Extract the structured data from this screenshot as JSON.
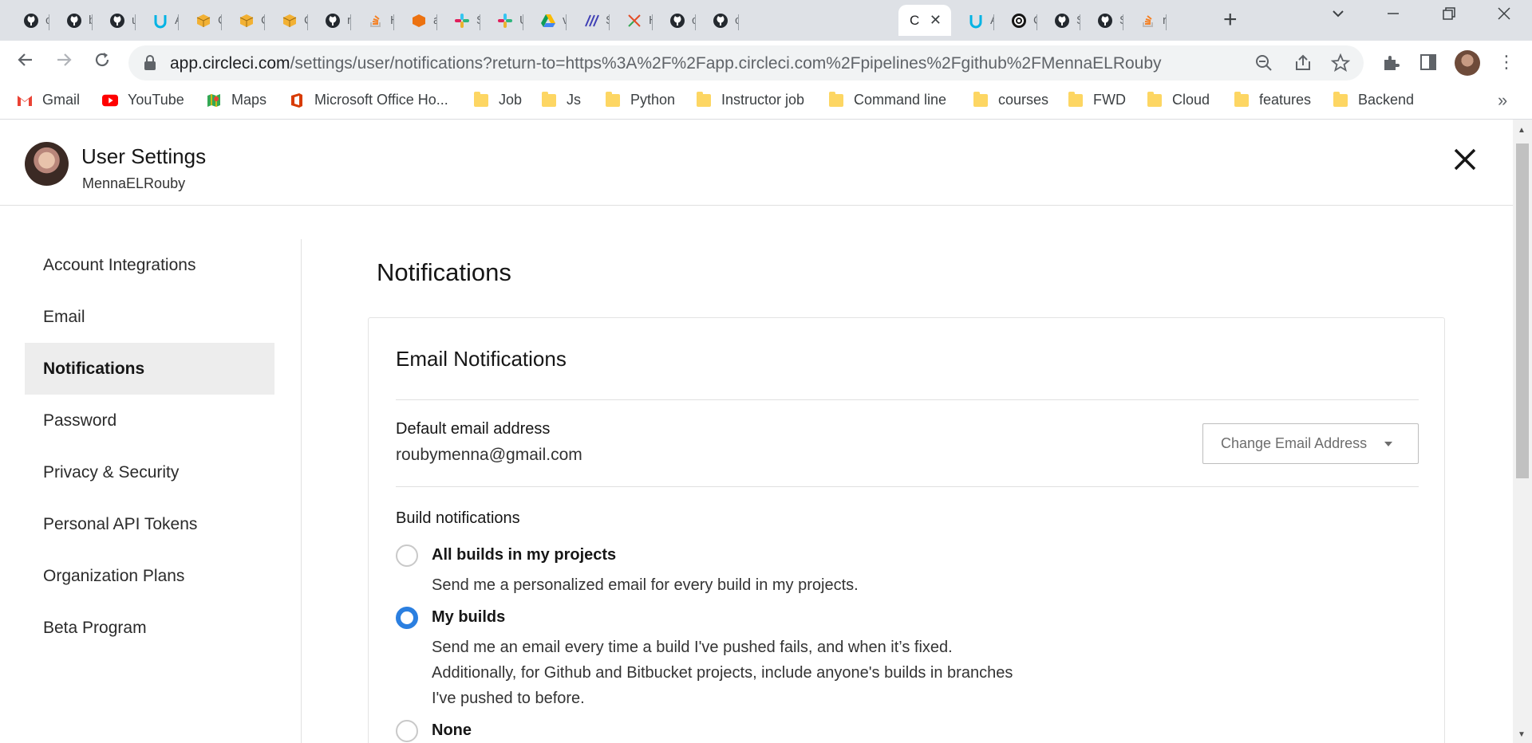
{
  "browser": {
    "tabs": [
      {
        "icon": "github-icon",
        "title": "c"
      },
      {
        "icon": "github-icon",
        "title": "b"
      },
      {
        "icon": "github-icon",
        "title": "u"
      },
      {
        "icon": "udacity-icon",
        "title": "A"
      },
      {
        "icon": "package-icon",
        "title": "C"
      },
      {
        "icon": "package-icon",
        "title": "C"
      },
      {
        "icon": "package-icon",
        "title": "C"
      },
      {
        "icon": "github-icon",
        "title": "r"
      },
      {
        "icon": "stackoverflow-icon",
        "title": "H"
      },
      {
        "icon": "aws-icon",
        "title": "a"
      },
      {
        "icon": "slack-icon",
        "title": "S"
      },
      {
        "icon": "slack-icon",
        "title": "U"
      },
      {
        "icon": "google-drive-icon",
        "title": "v"
      },
      {
        "icon": "linear-icon",
        "title": "S"
      },
      {
        "icon": "tool-icon",
        "title": "H"
      },
      {
        "icon": "github-icon",
        "title": "c"
      },
      {
        "icon": "github-icon",
        "title": "c"
      },
      {
        "icon": "circleci-icon",
        "title": "C",
        "active": true
      },
      {
        "icon": "udacity-icon",
        "title": "A"
      },
      {
        "icon": "circleci-icon",
        "title": "C"
      },
      {
        "icon": "github-icon",
        "title": "S"
      },
      {
        "icon": "github-icon",
        "title": "S"
      },
      {
        "icon": "stackoverflow-icon",
        "title": "r"
      }
    ],
    "url_host": "app.circleci.com",
    "url_path": "/settings/user/notifications?return-to=https%3A%2F%2Fapp.circleci.com%2Fpipelines%2Fgithub%2FMennaELRouby",
    "bookmarks": [
      {
        "icon": "gmail-icon",
        "label": "Gmail"
      },
      {
        "icon": "youtube-icon",
        "label": "YouTube"
      },
      {
        "icon": "maps-icon",
        "label": "Maps"
      },
      {
        "icon": "office-icon",
        "label": "Microsoft Office Ho..."
      },
      {
        "icon": "folder-icon",
        "label": "Job"
      },
      {
        "icon": "folder-icon",
        "label": "Js"
      },
      {
        "icon": "folder-icon",
        "label": "Python"
      },
      {
        "icon": "folder-icon",
        "label": "Instructor job"
      },
      {
        "icon": "folder-icon",
        "label": "Command line"
      },
      {
        "icon": "folder-icon",
        "label": "courses"
      },
      {
        "icon": "folder-icon",
        "label": "FWD"
      },
      {
        "icon": "folder-icon",
        "label": "Cloud"
      },
      {
        "icon": "folder-icon",
        "label": "features"
      },
      {
        "icon": "folder-icon",
        "label": "Backend"
      }
    ],
    "bookmarks_more": "»"
  },
  "header": {
    "title": "User Settings",
    "username": "MennaELRouby"
  },
  "sidebar": {
    "items": [
      {
        "label": "Account Integrations"
      },
      {
        "label": "Email"
      },
      {
        "label": "Notifications",
        "active": true
      },
      {
        "label": "Password"
      },
      {
        "label": "Privacy & Security"
      },
      {
        "label": "Personal API Tokens"
      },
      {
        "label": "Organization Plans"
      },
      {
        "label": "Beta Program"
      }
    ]
  },
  "main": {
    "title": "Notifications",
    "card": {
      "title": "Email Notifications",
      "default_email_label": "Default email address",
      "default_email_value": "roubymenna@gmail.com",
      "change_email_button": "Change Email Address",
      "build_notifications_label": "Build notifications",
      "options": [
        {
          "label": "All builds in my projects",
          "description": [
            "Send me a personalized email for every build in my projects."
          ],
          "checked": false
        },
        {
          "label": "My builds",
          "description": [
            "Send me an email every time a build I've pushed fails, and when it’s fixed.",
            "Additionally, for Github and Bitbucket projects, include anyone's builds in branches",
            "I've pushed to before."
          ],
          "checked": true
        },
        {
          "label": "None",
          "description": [],
          "checked": false
        }
      ]
    }
  },
  "colors": {
    "accent": "#2b7fe0",
    "active_nav_bg": "#ededed"
  }
}
